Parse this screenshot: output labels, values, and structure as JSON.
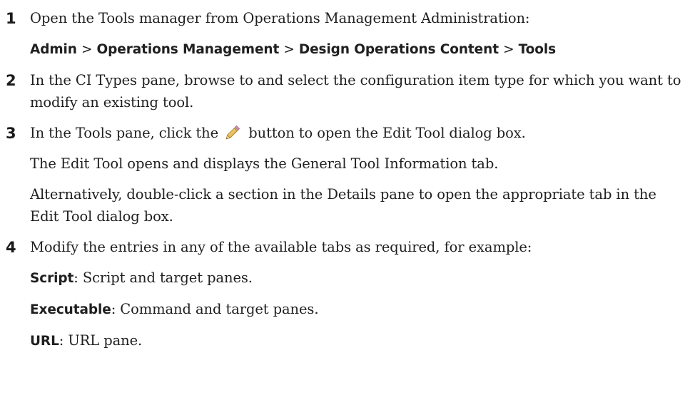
{
  "steps": [
    {
      "number": "1",
      "text": "Open the Tools manager from Operations Management Administration:",
      "path": {
        "items": [
          "Admin",
          "Operations Management",
          "Design Operations Content",
          "Tools"
        ],
        "separator": ">"
      }
    },
    {
      "number": "2",
      "text": "In the CI Types pane, browse to and select the configuration item type for which you want to modify an existing tool."
    },
    {
      "number": "3",
      "text_before": "In the Tools pane, click the",
      "icon": "pencil-edit-icon",
      "text_after": "button to open the Edit Tool dialog box.",
      "para2": "The Edit Tool opens and displays the General Tool Information tab.",
      "para3": "Alternatively, double-click a section in the Details pane to open the appropriate tab in the Edit Tool dialog box."
    },
    {
      "number": "4",
      "text": "Modify the entries in any of the available tabs as required, for example:",
      "examples": [
        {
          "term": "Script",
          "desc": ": Script and target panes."
        },
        {
          "term": "Executable",
          "desc": ": Command and target panes."
        },
        {
          "term": "URL",
          "desc": ": URL pane."
        }
      ]
    }
  ]
}
